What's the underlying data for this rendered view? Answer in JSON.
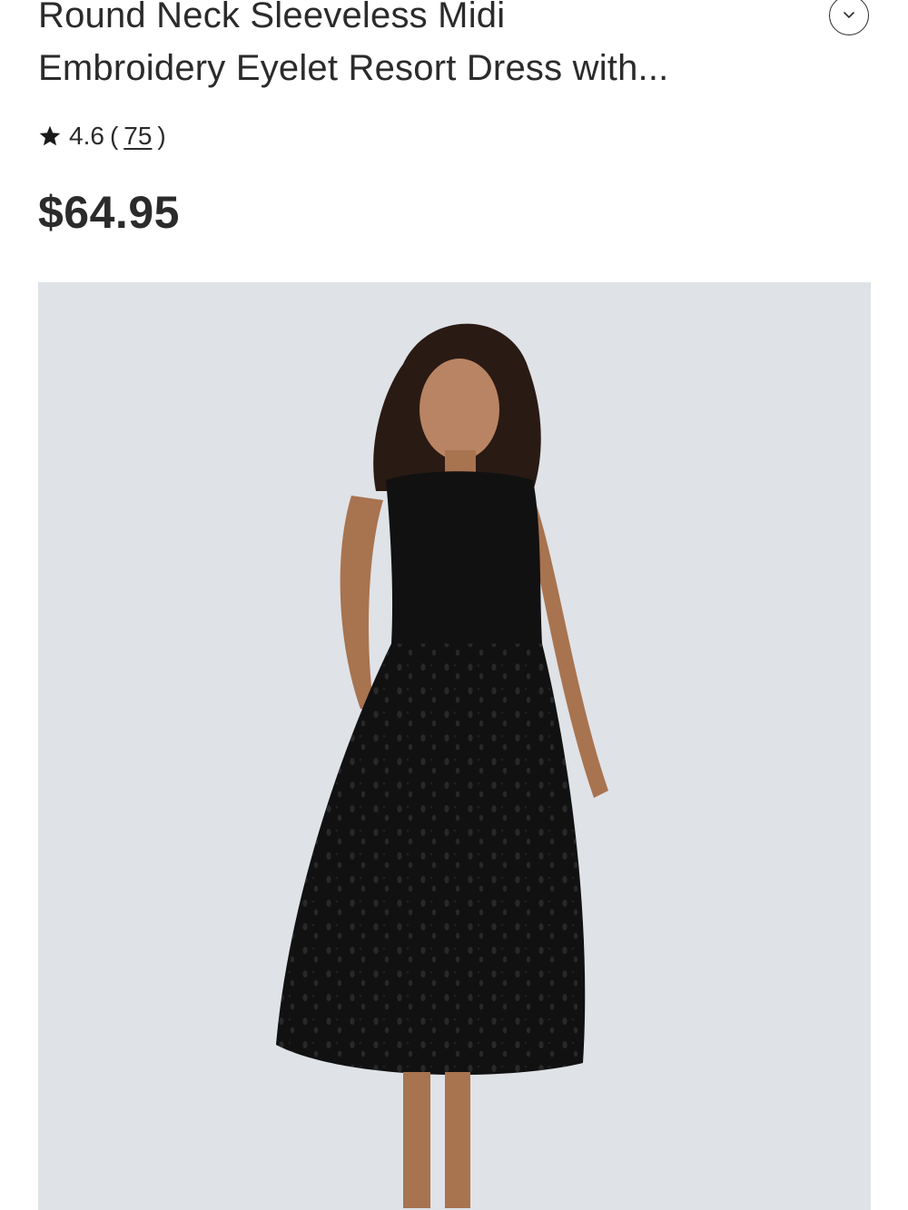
{
  "product": {
    "title_line1": "Round Neck Sleeveless Midi",
    "title_line2": "Embroidery Eyelet Resort Dress with...",
    "rating_value": "4.6",
    "rating_open": "(",
    "review_count": "75",
    "rating_close": ")",
    "price": "$64.95"
  },
  "icons": {
    "expand": "chevron-down-icon",
    "rating": "star-icon"
  },
  "colors": {
    "text": "#2b2b2b",
    "image_background": "#dfe2e7",
    "dress": "#111111"
  }
}
